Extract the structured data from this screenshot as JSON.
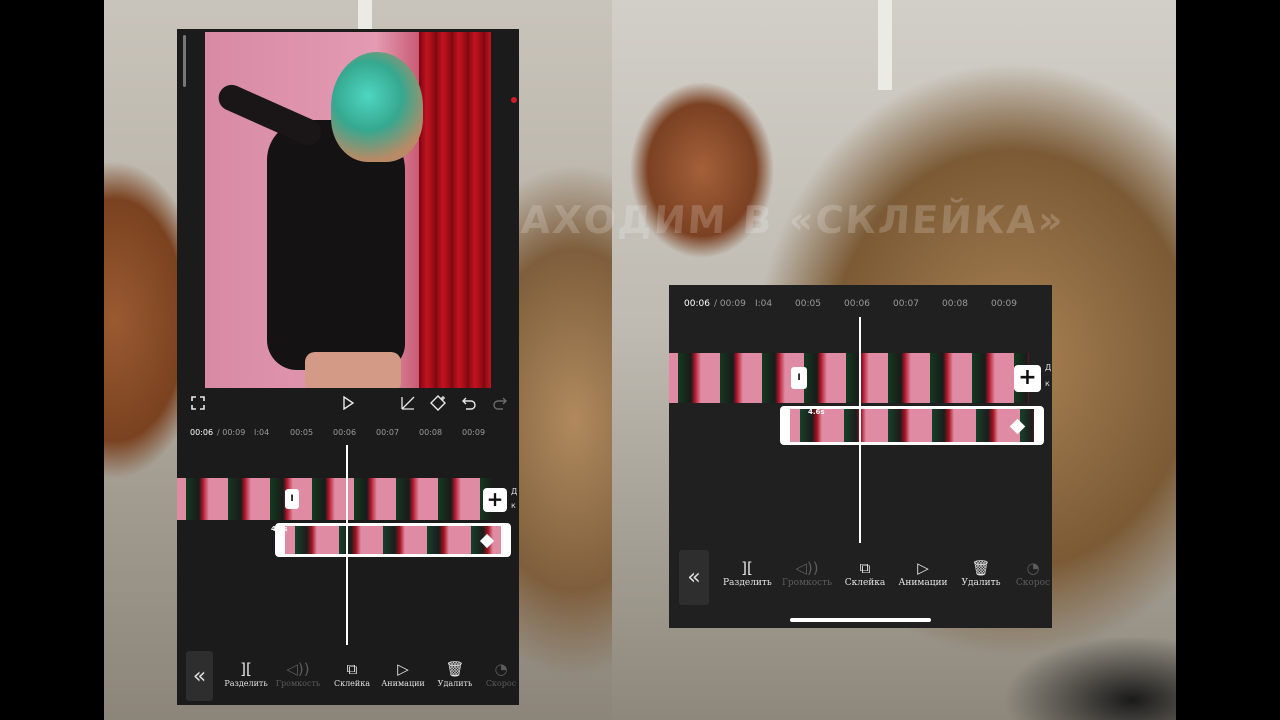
{
  "watermark": "ЗАХОДИМ В «СКЛЕЙКА»",
  "timeline": {
    "current": "00:06",
    "total": "/ 00:09",
    "ticks": [
      "I:04",
      "00:05",
      "00:06",
      "00:07",
      "00:08",
      "00:09"
    ],
    "clip_duration": "4.6s",
    "split_marker": "I",
    "add_button": "+",
    "side_text_1": "Д",
    "side_text_2": "к"
  },
  "preview_controls": {
    "fullscreen_icon": "fullscreen-icon",
    "play_icon": "play-icon",
    "keyframe_curve_icon": "curve-icon",
    "keyframe_icon": "keyframe-icon",
    "undo_icon": "undo-icon",
    "redo_icon": "redo-icon"
  },
  "toolbar": {
    "back_icon": "«",
    "split": "Разделить",
    "volume": "Громкость",
    "overlay": "Склейка",
    "animation": "Анимации",
    "delete": "Удалить",
    "speed": "Скорос"
  },
  "colors": {
    "panel_bg": "#1b1b1b",
    "playhead": "#ffffff",
    "disabled": "#5c5c5c"
  }
}
